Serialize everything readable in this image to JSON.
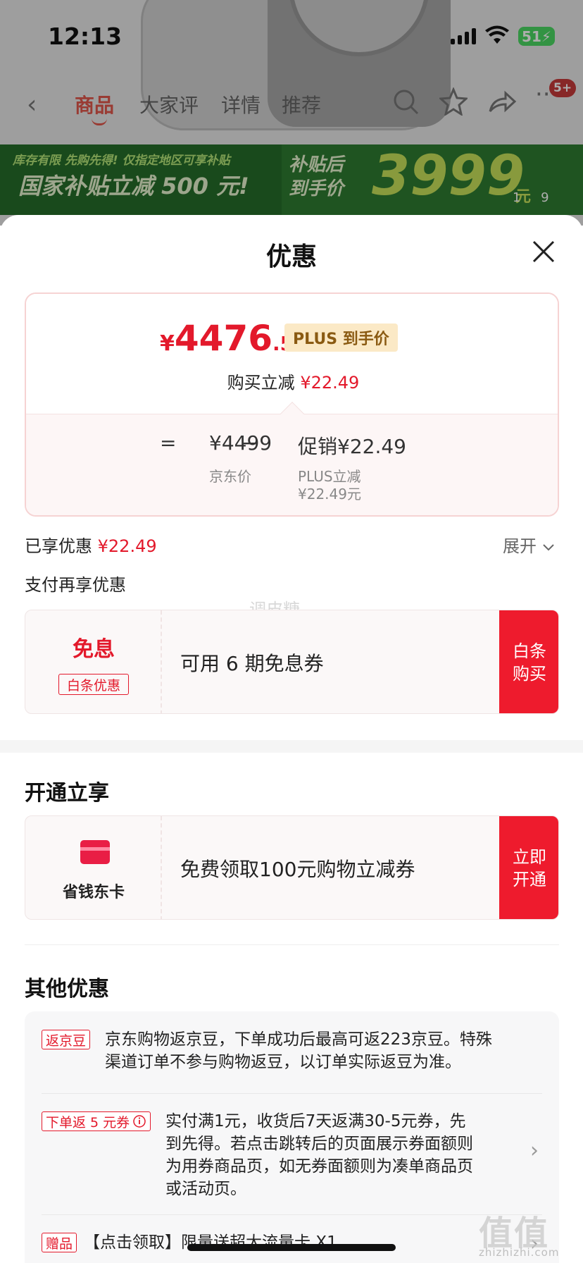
{
  "status_bar": {
    "time": "12:13",
    "battery": "51"
  },
  "nav": {
    "tabs": [
      "商品",
      "大家评",
      "详情",
      "推荐"
    ],
    "badge": "5+"
  },
  "promo": {
    "small_text": "库存有限 先购先得! 仅指定地区可享补贴",
    "big_text": "国家补贴立减 500 元!",
    "after_label_1": "补贴后",
    "after_label_2": "到手价",
    "price": "3999",
    "unit": "元",
    "pager_current": "1",
    "pager_total": "9"
  },
  "sheet": {
    "title": "优惠",
    "price_card": {
      "yen": "¥",
      "price_int": "4476",
      "price_dec": ".51",
      "plus_tag": "PLUS 到手价",
      "reduce_label": "购买立减",
      "reduce_value": "¥22.49",
      "formula": {
        "eq": "=",
        "base": "¥4499",
        "minus": "−",
        "promo": "促销¥22.49",
        "base_label": "京东价",
        "promo_label": "PLUS立减",
        "promo_detail": "¥22.49元"
      }
    },
    "enjoyed_label": "已享优惠",
    "enjoyed_value": "¥22.49",
    "expand_label": "展开",
    "pay_title": "支付再享优惠",
    "watermark": "调皮糖",
    "installment": {
      "title": "免息",
      "tag": "白条优惠",
      "desc": "可用 6 期免息券",
      "button": "白条购买"
    },
    "open_section_title": "开通立享",
    "card_offer": {
      "label": "省钱东卡",
      "desc": "免费领取100元购物立减券",
      "button": "立即开通"
    },
    "other_section_title": "其他优惠",
    "other_items": [
      {
        "tag": "返京豆",
        "line1": "京东购物返京豆，下单成功后最高可返223京豆。特殊",
        "line2": "渠道订单不参与购物返豆，以订单实际返豆为准。"
      },
      {
        "tag": "下单返 5 元券",
        "line1": "实付满1元，收货后7天返满30-5元券，先",
        "line2": "到先得。若点击跳转后的页面展示券面额则",
        "line3": "为用券商品页，如无券面额则为凑单商品页",
        "line4": "或活动页。"
      },
      {
        "tag": "赠品",
        "line1": "【点击领取】限量送超大流量卡 X1"
      }
    ]
  },
  "watermark_brand": {
    "mark": "值值值",
    "url": "zhizhizhi.com"
  }
}
